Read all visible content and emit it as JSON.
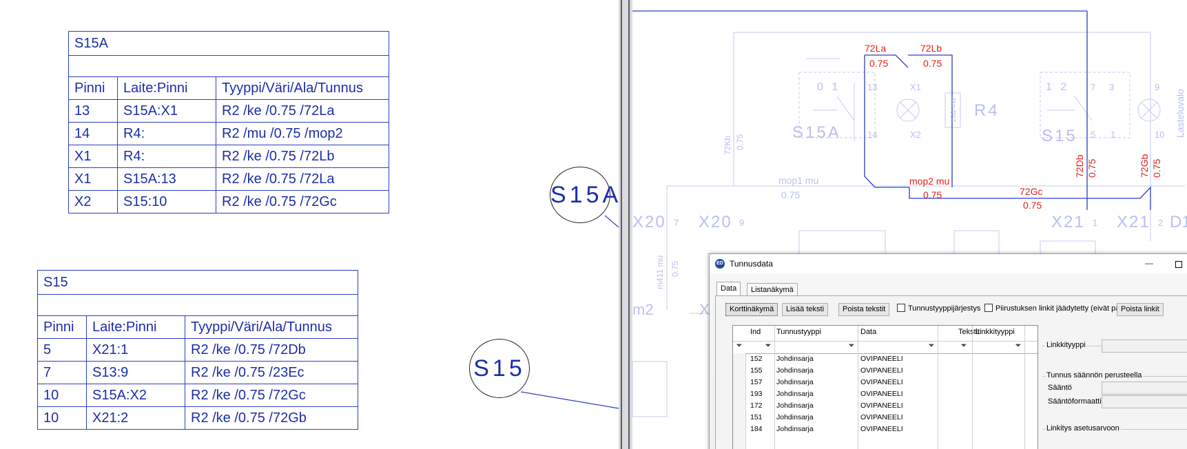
{
  "table_s15a": {
    "title": "S15A",
    "headers": [
      "Pinni",
      "Laite:Pinni",
      "Tyyppi/Väri/Ala/Tunnus"
    ],
    "rows": [
      [
        "13",
        "S15A:X1",
        "R2 /ke /0.75 /72La"
      ],
      [
        "14",
        "R4:",
        "R2 /mu /0.75 /mop2"
      ],
      [
        "X1",
        "R4:",
        "R2 /ke /0.75 /72Lb"
      ],
      [
        "X1",
        "S15A:13",
        "R2 /ke /0.75 /72La"
      ],
      [
        "X2",
        "S15:10",
        "R2 /ke /0.75 /72Gc"
      ]
    ]
  },
  "table_s15": {
    "title": "S15",
    "headers": [
      "Pinni",
      "Laite:Pinni",
      "Tyyppi/Väri/Ala/Tunnus"
    ],
    "rows": [
      [
        "5",
        "X21:1",
        "R2 /ke /0.75 /72Db"
      ],
      [
        "7",
        "S13:9",
        "R2 /ke /0.75 /23Ec"
      ],
      [
        "10",
        "S15A:X2",
        "R2 /ke /0.75 /72Gc"
      ],
      [
        "10",
        "X21:2",
        "R2 /ke /0.75 /72Gb"
      ]
    ]
  },
  "balloons": {
    "s15a": "S15A",
    "s15": "S15"
  },
  "drawing": {
    "red_labels": {
      "w72la": "72La",
      "w72la_area": "0.75",
      "w72lb": "72Lb",
      "w72lb_area": "0.75",
      "mop2": "mop2 mu",
      "mop2_area": "0.75",
      "w72gc": "72Gc",
      "w72gc_area": "0.75",
      "w72db": "72Db",
      "w72db_area": "0.75",
      "w72gb": "72Gb",
      "w72gb_area": "0.75"
    },
    "faint_labels": {
      "s15a": "S15A",
      "s15": "S15",
      "r4": "R4",
      "r4_value": "15Ω 4W",
      "pin13": "13",
      "pin14": "14",
      "pinx1": "X1",
      "pinx2": "X2",
      "pin7": "7",
      "pin3": "3",
      "pin9": "9",
      "pin5": "5",
      "pin1": "1",
      "pin10": "10",
      "sw_left": "0 1",
      "sw_right": "1 2",
      "w72kb": "72Kb",
      "w72kb_area": "0.75",
      "mop1": "mop1 mu",
      "mop1_area": "0.75",
      "x20_7": "X20",
      "x20_7_pin": "7",
      "x20_9": "X20",
      "x20_9_pin": "9",
      "x21_1": "X21",
      "x21_1_pin": "1",
      "x21_2": "X21",
      "x21_2_pin": "2",
      "d1": "D1",
      "m411": "m411 mu",
      "m411_area": "0.75",
      "m2": "m2",
      "x_cut": "X",
      "vertical_right": "Lasteluvalo"
    }
  },
  "dialog": {
    "title": "Tunnusdata",
    "icon": "ED",
    "tabs": [
      "Data",
      "Listanäkymä"
    ],
    "toolbar": {
      "card_view": "Korttinäkymä",
      "add_text": "Lisää teksti",
      "remove_texts": "Poista tekstit",
      "type_order": "Tunnustyyppijärjestys",
      "link_freeze": "Piirustuksen linkit jäädytetty (eivät päivity)",
      "remove_link": "Poista linkit"
    },
    "grid": {
      "columns": [
        "Ind",
        "Tunnustyyppi",
        "Data",
        "Tekstit",
        "Linkkityyppi"
      ],
      "rows": [
        [
          "152",
          "Johdinsarja",
          "OVIPANEELI"
        ],
        [
          "155",
          "Johdinsarja",
          "OVIPANEELI"
        ],
        [
          "157",
          "Johdinsarja",
          "OVIPANEELI"
        ],
        [
          "193",
          "Johdinsarja",
          "OVIPANEELI"
        ],
        [
          "172",
          "Johdinsarja",
          "OVIPANEELI"
        ],
        [
          "151",
          "Johdinsarja",
          "OVIPANEELI"
        ],
        [
          "184",
          "Johdinsarja",
          "OVIPANEELI"
        ]
      ]
    },
    "form": {
      "link_type": "Linkkityyppi",
      "rule_group": "Tunnus säännön perusteella",
      "rule": "Sääntö",
      "rule_format": "Sääntöformaatti",
      "setting_group": "Linkitys asetusarvoon"
    }
  },
  "colors": {
    "table_blue": "#2b3fc0",
    "wire_red": "#e0201a",
    "faint_blue": "#b8bff0",
    "wire_blue": "#2a3dc8"
  }
}
